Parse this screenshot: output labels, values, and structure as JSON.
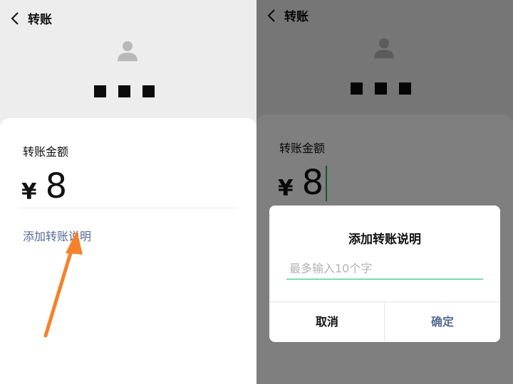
{
  "left_screen": {
    "title": "转账",
    "amount_label": "转账金额",
    "currency_symbol": "¥",
    "amount": "8",
    "add_note_link": "添加转账说明"
  },
  "right_screen": {
    "title": "转账",
    "amount_label": "转账金额",
    "currency_symbol": "¥",
    "amount": "8",
    "dialog": {
      "title": "添加转账说明",
      "input_placeholder": "最多输入10个字",
      "input_value": "",
      "cancel_label": "取消",
      "confirm_label": "确定"
    }
  },
  "icons": {
    "back": "chevron-left-icon",
    "avatar": "user-avatar-icon",
    "annotation_arrow": "arrow-up-icon"
  },
  "colors": {
    "link": "#576b95",
    "accent_green": "#07c160",
    "arrow": "#f5822a"
  }
}
